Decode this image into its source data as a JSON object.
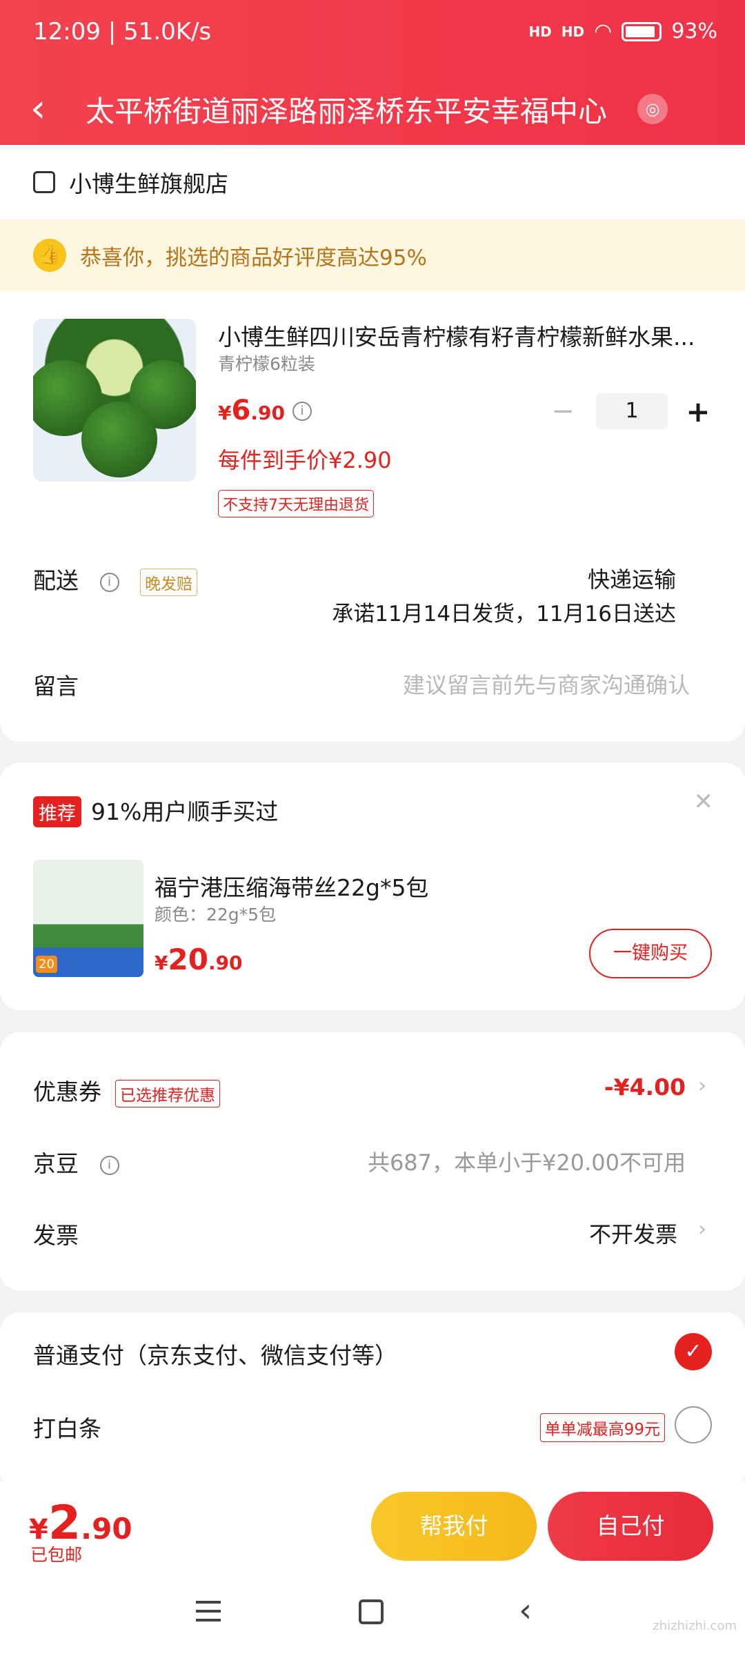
{
  "status": {
    "time": "12:09 | 51.0K/s",
    "signal1": "HD",
    "signal2": "HD",
    "battery": "93%"
  },
  "header": {
    "address": "太平桥街道丽泽路丽泽桥东平安幸福中心"
  },
  "shop": {
    "name": "小博生鲜旗舰店"
  },
  "congrats": "恭喜你，挑选的商品好评度高达95%",
  "product": {
    "title": "小博生鲜四川安岳青柠檬有籽青柠檬新鲜水果...",
    "spec": "青柠檬6粒装",
    "price_currency": "¥",
    "price_int": "6",
    "price_dec": ".90",
    "final_price": "每件到手价¥2.90",
    "no_return": "不支持7天无理由退货",
    "qty": "1"
  },
  "delivery": {
    "label": "配送",
    "tag": "晚发赔",
    "type": "快递运输",
    "promise": "承诺11月14日发货，11月16日送达"
  },
  "message": {
    "label": "留言",
    "placeholder": "建议留言前先与商家沟通确认"
  },
  "recommend": {
    "tag": "推荐",
    "title": "91%用户顺手买过",
    "item_title": "福宁港压缩海带丝22g*5包",
    "item_spec": "颜色：22g*5包",
    "price_currency": "¥",
    "price_int": "20",
    "price_dec": ".90",
    "buy_label": "一键购买",
    "img_badge": "20"
  },
  "discounts": {
    "coupon_label": "优惠券",
    "coupon_tag": "已选推荐优惠",
    "coupon_value": "-¥4.00",
    "bean_label": "京豆",
    "bean_text": "共687，本单小于¥20.00不可用",
    "invoice_label": "发票",
    "invoice_value": "不开发票"
  },
  "payment": {
    "normal": "普通支付（京东支付、微信支付等）",
    "baitiao": "打白条",
    "baitiao_tag": "单单减最高99元"
  },
  "footer": {
    "currency": "¥",
    "total_int": "2",
    "total_dec": ".90",
    "free_ship": "已包邮",
    "help_pay": "帮我付",
    "self_pay": "自己付"
  },
  "watermark": "zhizhizhi.com"
}
